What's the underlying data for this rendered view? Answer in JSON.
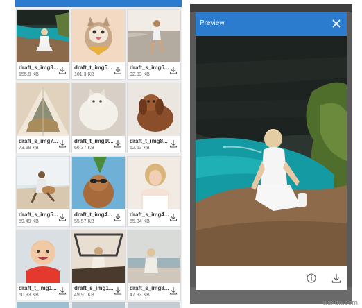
{
  "gallery": {
    "items": [
      {
        "name": "draft_s_img3...",
        "size": "155.9 KB",
        "image": "woman-seaside-cliff"
      },
      {
        "name": "draft_t_img5...",
        "size": "101.3 KB",
        "image": "cat-with-bandana"
      },
      {
        "name": "draft_s_img6...",
        "size": "92.83 KB",
        "image": "woman-on-road"
      },
      {
        "name": "draft_s_img7...",
        "size": "73.58 KB",
        "image": "tent-view"
      },
      {
        "name": "draft_t_img10...",
        "size": "66.37 KB",
        "image": "fluffy-cat"
      },
      {
        "name": "draft_t_img8...",
        "size": "62.63 KB",
        "image": "spaniel-dog"
      },
      {
        "name": "draft_s_img5...",
        "size": "59.49 KB",
        "image": "man-with-guitar"
      },
      {
        "name": "draft_t_img4...",
        "size": "55.57 KB",
        "image": "dog-with-sunglasses"
      },
      {
        "name": "draft_s_img4...",
        "size": "55.34 KB",
        "image": "blonde-woman"
      },
      {
        "name": "draft_t_img1...",
        "size": "50.93 KB",
        "image": "smiling-baby"
      },
      {
        "name": "draft_s_img1...",
        "size": "49.91 KB",
        "image": "woman-in-jeep"
      },
      {
        "name": "draft_s_img8...",
        "size": "47.93 KB",
        "image": "woman-by-sea"
      }
    ],
    "download_icon": "download-icon"
  },
  "preview": {
    "title": "Preview",
    "close_icon": "close-icon",
    "info_icon": "info-icon",
    "download_icon": "download-icon",
    "image": "woman-sitting-on-sea-cliff"
  },
  "watermark": "wsxdn.com",
  "colors": {
    "accent": "#2b7bcf",
    "card_bg": "#ffffff",
    "grid_bg": "#eceef0"
  }
}
